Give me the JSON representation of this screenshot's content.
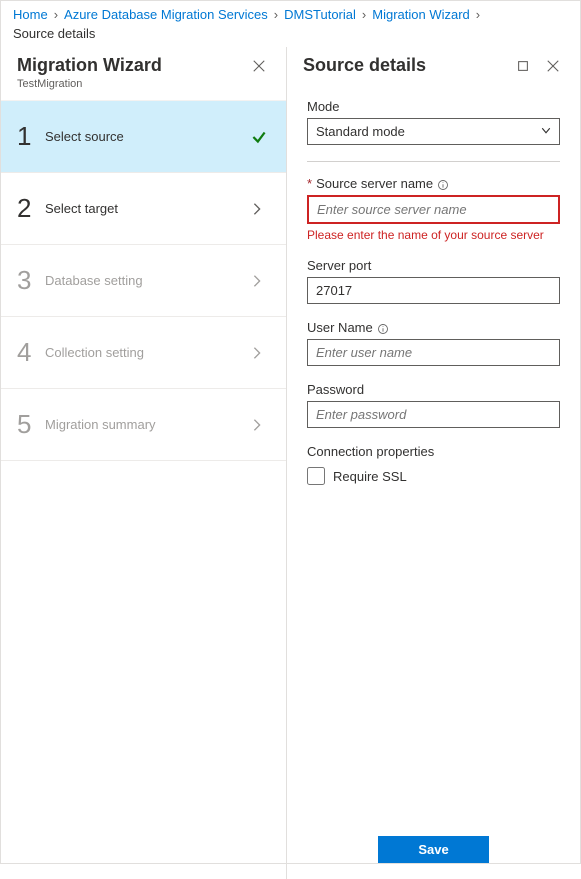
{
  "breadcrumb": {
    "items": [
      {
        "label": "Home"
      },
      {
        "label": "Azure Database Migration Services"
      },
      {
        "label": "DMSTutorial"
      },
      {
        "label": "Migration Wizard"
      }
    ],
    "current": "Source details"
  },
  "leftPanel": {
    "title": "Migration Wizard",
    "subtitle": "TestMigration",
    "steps": [
      {
        "num": "1",
        "label": "Select source",
        "state": "active-complete"
      },
      {
        "num": "2",
        "label": "Select target",
        "state": "pending"
      },
      {
        "num": "3",
        "label": "Database setting",
        "state": "inactive"
      },
      {
        "num": "4",
        "label": "Collection setting",
        "state": "inactive"
      },
      {
        "num": "5",
        "label": "Migration summary",
        "state": "inactive"
      }
    ]
  },
  "rightPanel": {
    "title": "Source details",
    "mode": {
      "label": "Mode",
      "value": "Standard mode"
    },
    "sourceServer": {
      "label": "Source server name",
      "required": true,
      "placeholder": "Enter source server name",
      "value": "",
      "error": "Please enter the name of your source server"
    },
    "serverPort": {
      "label": "Server port",
      "value": "27017"
    },
    "userName": {
      "label": "User Name",
      "placeholder": "Enter user name",
      "value": ""
    },
    "password": {
      "label": "Password",
      "placeholder": "Enter password",
      "value": ""
    },
    "connectionSection": {
      "title": "Connection properties",
      "requireSslLabel": "Require SSL",
      "requireSslChecked": false
    },
    "saveLabel": "Save"
  }
}
